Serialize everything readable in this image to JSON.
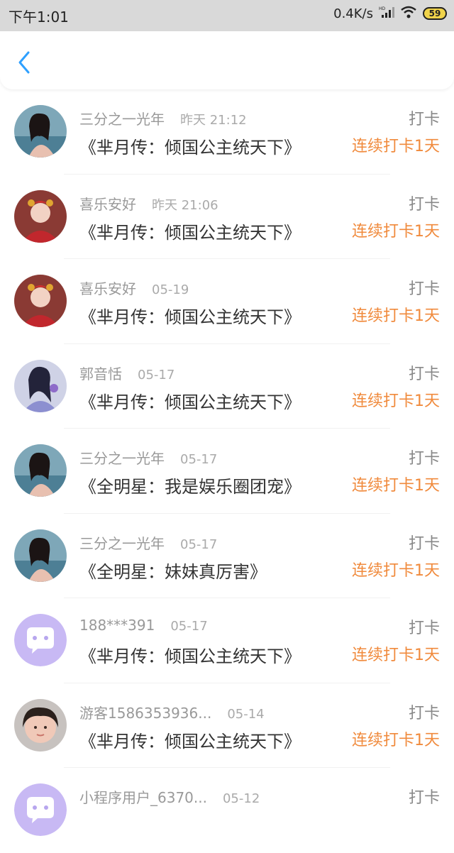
{
  "status_bar": {
    "time": "下午1:01",
    "net_speed": "0.4K/s",
    "battery": "59",
    "icons": [
      "hd-signal-icon",
      "wifi-icon",
      "battery-icon"
    ]
  },
  "nav": {
    "back_icon": "chevron-left-icon",
    "accent": "#2ea0ff"
  },
  "colors": {
    "streak": "#f08a3c",
    "muted": "#999999",
    "title": "#333333"
  },
  "records": [
    {
      "username": "三分之一光年",
      "time": "昨天 21:12",
      "book": "《芈月传：倾国公主统天下》",
      "action": "打卡",
      "streak": "连续打卡1天",
      "avatar": "photo-avatar-teal"
    },
    {
      "username": "喜乐安好",
      "time": "昨天 21:06",
      "book": "《芈月传：倾国公主统天下》",
      "action": "打卡",
      "streak": "连续打卡1天",
      "avatar": "photo-avatar-red"
    },
    {
      "username": "喜乐安好",
      "time": "05-19",
      "book": "《芈月传：倾国公主统天下》",
      "action": "打卡",
      "streak": "连续打卡1天",
      "avatar": "photo-avatar-red"
    },
    {
      "username": "郭音恬",
      "time": "05-17",
      "book": "《芈月传：倾国公主统天下》",
      "action": "打卡",
      "streak": "连续打卡1天",
      "avatar": "photo-avatar-purple"
    },
    {
      "username": "三分之一光年",
      "time": "05-17",
      "book": "《全明星：我是娱乐圈团宠》",
      "action": "打卡",
      "streak": "连续打卡1天",
      "avatar": "photo-avatar-teal"
    },
    {
      "username": "三分之一光年",
      "time": "05-17",
      "book": "《全明星：妹妹真厉害》",
      "action": "打卡",
      "streak": "连续打卡1天",
      "avatar": "photo-avatar-teal"
    },
    {
      "username": "188***391",
      "time": "05-17",
      "book": "《芈月传：倾国公主统天下》",
      "action": "打卡",
      "streak": "连续打卡1天",
      "avatar": "default-chat-avatar-icon"
    },
    {
      "username": "游客1586353936...",
      "time": "05-14",
      "book": "《芈月传：倾国公主统天下》",
      "action": "打卡",
      "streak": "连续打卡1天",
      "avatar": "photo-avatar-child"
    },
    {
      "username": "小程序用户_6370...",
      "time": "05-12",
      "book": "",
      "action": "打卡",
      "streak": "",
      "avatar": "default-chat-avatar-icon"
    }
  ]
}
